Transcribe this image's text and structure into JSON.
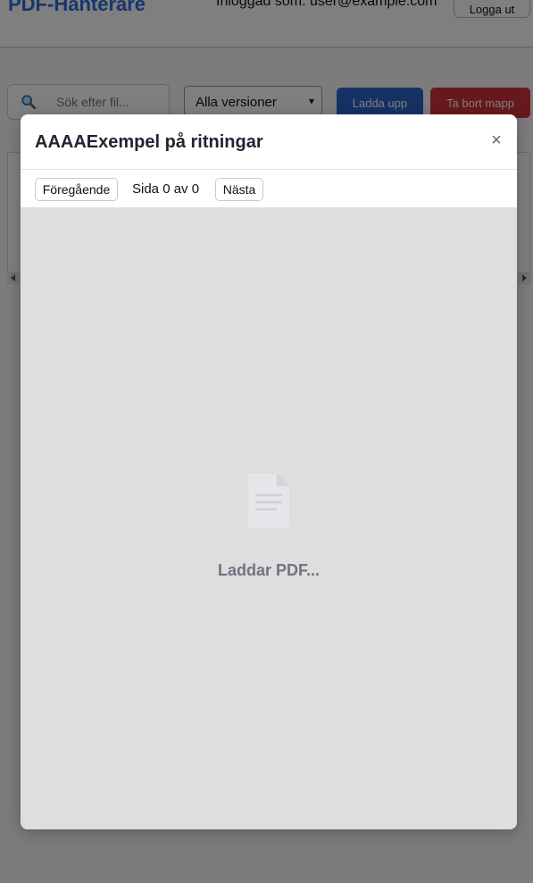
{
  "header": {
    "app_title": "PDF-Hanterare",
    "user_label": "Inloggad som: user@example.com",
    "logout_label": "Logga ut"
  },
  "toolbar": {
    "search_placeholder": "Sök efter fil...",
    "version_select_value": "Alla versioner",
    "upload_label": "Ladda upp",
    "delete_folder_label": "Ta bort mapp",
    "upload_color": "#2c64c8",
    "delete_color": "#d0323a"
  },
  "modal": {
    "title": "AAAAExempel på ritningar",
    "close_label": "×",
    "pager": {
      "prev_label": "Föregående",
      "page_indicator": "Sida 0 av 0",
      "next_label": "Nästa"
    },
    "viewer": {
      "icon": "document-icon",
      "loading_text": "Laddar PDF..."
    }
  },
  "colors": {
    "brand": "#2b6cd8",
    "overlay": "rgba(0,0,0,0.5)",
    "viewer_bg": "#dedede"
  }
}
